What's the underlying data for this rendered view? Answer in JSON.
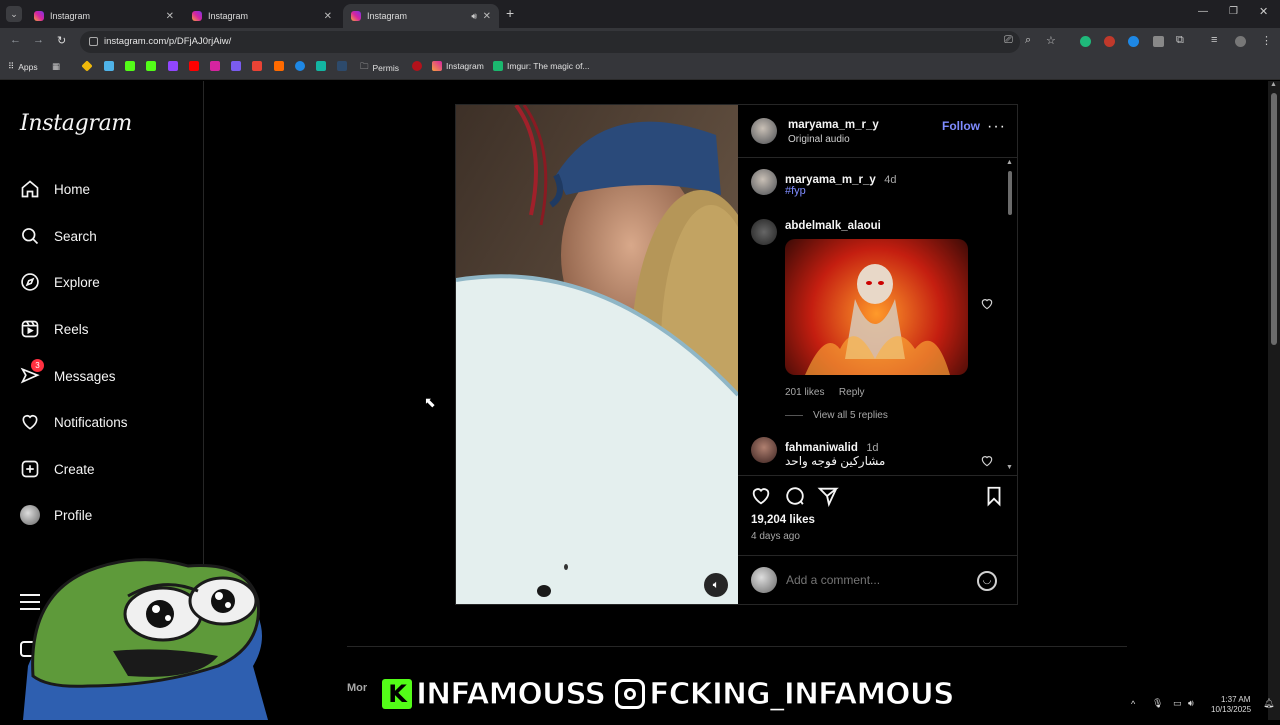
{
  "browser": {
    "tabs": [
      {
        "title": "Instagram",
        "active": false
      },
      {
        "title": "Instagram",
        "active": false
      },
      {
        "title": "Instagram",
        "active": true
      }
    ],
    "url": "instagram.com/p/DFjAJ0rjAiw/",
    "bookmarks": [
      "Apps",
      "Permis",
      "Instagram",
      "Imgur: The magic of..."
    ]
  },
  "sidebar": {
    "logo": "Instagram",
    "items": [
      {
        "label": "Home",
        "icon": "home-icon"
      },
      {
        "label": "Search",
        "icon": "search-icon"
      },
      {
        "label": "Explore",
        "icon": "compass-icon"
      },
      {
        "label": "Reels",
        "icon": "reels-icon"
      },
      {
        "label": "Messages",
        "icon": "messenger-icon",
        "badge": "3"
      },
      {
        "label": "Notifications",
        "icon": "heart-icon"
      },
      {
        "label": "Create",
        "icon": "plus-icon"
      },
      {
        "label": "Profile",
        "icon": "avatar"
      }
    ]
  },
  "post": {
    "author": "maryama_m_r_y",
    "audio": "Original audio",
    "follow_label": "Follow",
    "caption_author": "maryama_m_r_y",
    "caption_age": "4d",
    "caption_tag": "#fyp",
    "comments": [
      {
        "user": "abdelmalk_alaoui",
        "text": "",
        "likes": "201 likes",
        "reply": "Reply",
        "view_replies": "View all 5 replies"
      },
      {
        "user": "fahmaniwalid",
        "age": "1d",
        "text": "مشاركين فوجه واحد"
      }
    ],
    "likes": "19,204 likes",
    "time": "4 days ago",
    "comment_placeholder": "Add a comment..."
  },
  "overlay": {
    "kick_letter": "K",
    "kick_name": "INFAMOUSS",
    "ig_name": "FCKING_INFAMOUS"
  },
  "footer": {
    "more_partial": "Mor"
  },
  "tray": {
    "time": "1:37 AM",
    "date": "10/13/2025"
  },
  "colors": {
    "accent": "#0095f6",
    "link": "#e0f1ff",
    "badge": "#ff3040",
    "kick": "#53fc18"
  }
}
